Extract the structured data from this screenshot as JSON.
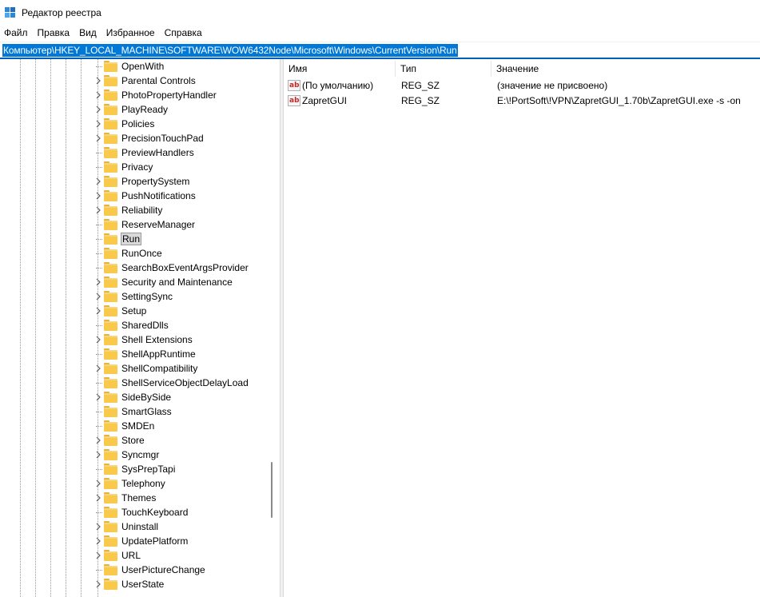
{
  "window": {
    "title": "Редактор реестра",
    "icon": "regedit-icon"
  },
  "menu": [
    "Файл",
    "Правка",
    "Вид",
    "Избранное",
    "Справка"
  ],
  "address": "Компьютер\\HKEY_LOCAL_MACHINE\\SOFTWARE\\WOW6432Node\\Microsoft\\Windows\\CurrentVersion\\Run",
  "tree": {
    "selected": "Run",
    "items": [
      {
        "label": "OpenWith",
        "expandable": false
      },
      {
        "label": "Parental Controls",
        "expandable": true
      },
      {
        "label": "PhotoPropertyHandler",
        "expandable": true
      },
      {
        "label": "PlayReady",
        "expandable": true
      },
      {
        "label": "Policies",
        "expandable": true
      },
      {
        "label": "PrecisionTouchPad",
        "expandable": true
      },
      {
        "label": "PreviewHandlers",
        "expandable": false
      },
      {
        "label": "Privacy",
        "expandable": false
      },
      {
        "label": "PropertySystem",
        "expandable": true
      },
      {
        "label": "PushNotifications",
        "expandable": true
      },
      {
        "label": "Reliability",
        "expandable": true
      },
      {
        "label": "ReserveManager",
        "expandable": false
      },
      {
        "label": "Run",
        "expandable": false
      },
      {
        "label": "RunOnce",
        "expandable": false
      },
      {
        "label": "SearchBoxEventArgsProvider",
        "expandable": false
      },
      {
        "label": "Security and Maintenance",
        "expandable": true
      },
      {
        "label": "SettingSync",
        "expandable": true
      },
      {
        "label": "Setup",
        "expandable": true
      },
      {
        "label": "SharedDlls",
        "expandable": false
      },
      {
        "label": "Shell Extensions",
        "expandable": true
      },
      {
        "label": "ShellAppRuntime",
        "expandable": false
      },
      {
        "label": "ShellCompatibility",
        "expandable": true
      },
      {
        "label": "ShellServiceObjectDelayLoad",
        "expandable": false
      },
      {
        "label": "SideBySide",
        "expandable": true
      },
      {
        "label": "SmartGlass",
        "expandable": false
      },
      {
        "label": "SMDEn",
        "expandable": false
      },
      {
        "label": "Store",
        "expandable": true
      },
      {
        "label": "Syncmgr",
        "expandable": true
      },
      {
        "label": "SysPrepTapi",
        "expandable": false
      },
      {
        "label": "Telephony",
        "expandable": true
      },
      {
        "label": "Themes",
        "expandable": true
      },
      {
        "label": "TouchKeyboard",
        "expandable": false
      },
      {
        "label": "Uninstall",
        "expandable": true
      },
      {
        "label": "UpdatePlatform",
        "expandable": true
      },
      {
        "label": "URL",
        "expandable": true
      },
      {
        "label": "UserPictureChange",
        "expandable": false
      },
      {
        "label": "UserState",
        "expandable": true
      }
    ]
  },
  "list": {
    "columns": [
      "Имя",
      "Тип",
      "Значение"
    ],
    "rows": [
      {
        "icon": "string-value-icon",
        "name": "(По умолчанию)",
        "type": "REG_SZ",
        "value": "(значение не присвоено)"
      },
      {
        "icon": "string-value-icon",
        "name": "ZapretGUI",
        "type": "REG_SZ",
        "value": "E:\\!PortSoft\\!VPN\\ZapretGUI_1.70b\\ZapretGUI.exe -s -on"
      }
    ]
  },
  "colors": {
    "address_highlight": "#0078d7",
    "folder": "#f8c94b",
    "selection": "#d9d9d9"
  }
}
